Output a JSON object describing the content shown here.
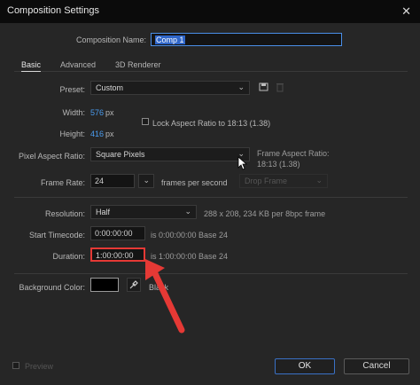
{
  "window": {
    "title": "Composition Settings",
    "close_glyph": "✕"
  },
  "composition": {
    "name_label": "Composition Name:",
    "name_value": "Comp 1"
  },
  "tabs": [
    "Basic",
    "Advanced",
    "3D Renderer"
  ],
  "preset": {
    "label": "Preset:",
    "value": "Custom"
  },
  "width": {
    "label": "Width:",
    "value": "576",
    "unit": "px"
  },
  "height": {
    "label": "Height:",
    "value": "416",
    "unit": "px"
  },
  "lock_aspect": {
    "label": "Lock Aspect Ratio to 18:13 (1.38)",
    "checked": false
  },
  "pixel_aspect": {
    "label": "Pixel Aspect Ratio:",
    "value": "Square Pixels",
    "frame_label": "Frame Aspect Ratio:",
    "frame_value": "18:13 (1.38)"
  },
  "frame_rate": {
    "label": "Frame Rate:",
    "value": "24",
    "unit_label": "frames per second",
    "drop_frame": "Drop Frame"
  },
  "resolution": {
    "label": "Resolution:",
    "value": "Half",
    "info": "288 x 208, 234 KB per 8bpc frame"
  },
  "start_timecode": {
    "label": "Start Timecode:",
    "value": "0:00:00:00",
    "info": "is 0:00:00:00  Base 24"
  },
  "duration": {
    "label": "Duration:",
    "value": "1:00:00:00",
    "info": "is 1:00:00:00  Base 24"
  },
  "background": {
    "label": "Background Color:",
    "color": "#000000",
    "name": "Black"
  },
  "footer": {
    "preview_label": "Preview",
    "ok_label": "OK",
    "cancel_label": "Cancel"
  },
  "colors": {
    "accent_blue": "#4a9cf0",
    "highlight_red": "#e53935"
  },
  "icons": [
    "chevron-down-icon",
    "save-preset-icon",
    "delete-preset-icon",
    "eyedropper-icon",
    "close-icon",
    "mouse-cursor-icon",
    "callout-arrow-icon"
  ]
}
